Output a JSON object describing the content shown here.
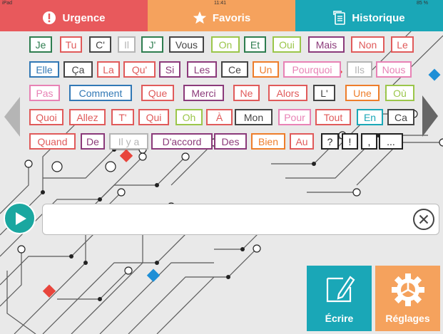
{
  "status": {
    "device": "iPad",
    "time": "11:41",
    "battery": "85 %"
  },
  "tabs": [
    {
      "label": "Urgence",
      "icon": "exclamation-icon",
      "color": "#e8595c"
    },
    {
      "label": "Favoris",
      "icon": "star-icon",
      "color": "#f5a25d"
    },
    {
      "label": "Historique",
      "icon": "history-icon",
      "color": "#1aa7b7"
    }
  ],
  "colors": {
    "green": "#2e7d4f",
    "red": "#e05a5a",
    "gray": "#444",
    "lightgray": "#b5b5b5",
    "lime": "#9bc64a",
    "purple": "#8b3a7a",
    "orange": "#ee7d2a",
    "pink": "#e882b5",
    "blue": "#3178b5",
    "teal": "#1aa7b7",
    "black": "#222"
  },
  "words": [
    {
      "text": "Je",
      "color": "green"
    },
    {
      "text": "Tu",
      "color": "red"
    },
    {
      "text": "C'",
      "color": "gray"
    },
    {
      "text": "Il",
      "color": "lightgray"
    },
    {
      "text": "J'",
      "color": "green"
    },
    {
      "text": "Vous",
      "color": "gray"
    },
    {
      "text": "On",
      "color": "lime"
    },
    {
      "text": "Et",
      "color": "green"
    },
    {
      "text": "Oui",
      "color": "lime"
    },
    {
      "text": "Mais",
      "color": "purple"
    },
    {
      "text": "Non",
      "color": "red"
    },
    {
      "text": "Le",
      "color": "red"
    },
    {
      "text": "Elle",
      "color": "blue"
    },
    {
      "text": "Ça",
      "color": "gray"
    },
    {
      "text": "La",
      "color": "red"
    },
    {
      "text": "Qu'",
      "color": "red"
    },
    {
      "text": "Si",
      "color": "purple"
    },
    {
      "text": "Les",
      "color": "purple"
    },
    {
      "text": "Ce",
      "color": "gray"
    },
    {
      "text": "Un",
      "color": "orange"
    },
    {
      "text": "Pourquoi",
      "color": "pink"
    },
    {
      "text": "Ils",
      "color": "lightgray"
    },
    {
      "text": "Nous",
      "color": "pink"
    },
    {
      "text": "Pas",
      "color": "pink"
    },
    {
      "text": "Comment",
      "color": "blue"
    },
    {
      "text": "Que",
      "color": "red"
    },
    {
      "text": "Merci",
      "color": "purple"
    },
    {
      "text": "Ne",
      "color": "red"
    },
    {
      "text": "Alors",
      "color": "red"
    },
    {
      "text": "L'",
      "color": "gray"
    },
    {
      "text": "Une",
      "color": "orange"
    },
    {
      "text": "Où",
      "color": "lime"
    },
    {
      "text": "Quoi",
      "color": "red"
    },
    {
      "text": "Allez",
      "color": "red"
    },
    {
      "text": "T'",
      "color": "red"
    },
    {
      "text": "Qui",
      "color": "red"
    },
    {
      "text": "Oh",
      "color": "lime"
    },
    {
      "text": "À",
      "color": "red"
    },
    {
      "text": "Mon",
      "color": "gray"
    },
    {
      "text": "Pour",
      "color": "pink"
    },
    {
      "text": "Tout",
      "color": "red"
    },
    {
      "text": "En",
      "color": "teal"
    },
    {
      "text": "Ca",
      "color": "gray"
    },
    {
      "text": "Quand",
      "color": "red"
    },
    {
      "text": "De",
      "color": "purple"
    },
    {
      "text": "Il y a",
      "color": "lightgray"
    },
    {
      "text": "D'accord",
      "color": "purple"
    },
    {
      "text": "Des",
      "color": "purple"
    },
    {
      "text": "Bien",
      "color": "orange"
    },
    {
      "text": "Au",
      "color": "red"
    },
    {
      "text": "?",
      "color": "black"
    },
    {
      "text": "!",
      "color": "black"
    },
    {
      "text": ",",
      "color": "black"
    },
    {
      "text": "...",
      "color": "black"
    }
  ],
  "input": {
    "value": ""
  },
  "buttons": {
    "write": "Écrire",
    "settings": "Réglages"
  }
}
